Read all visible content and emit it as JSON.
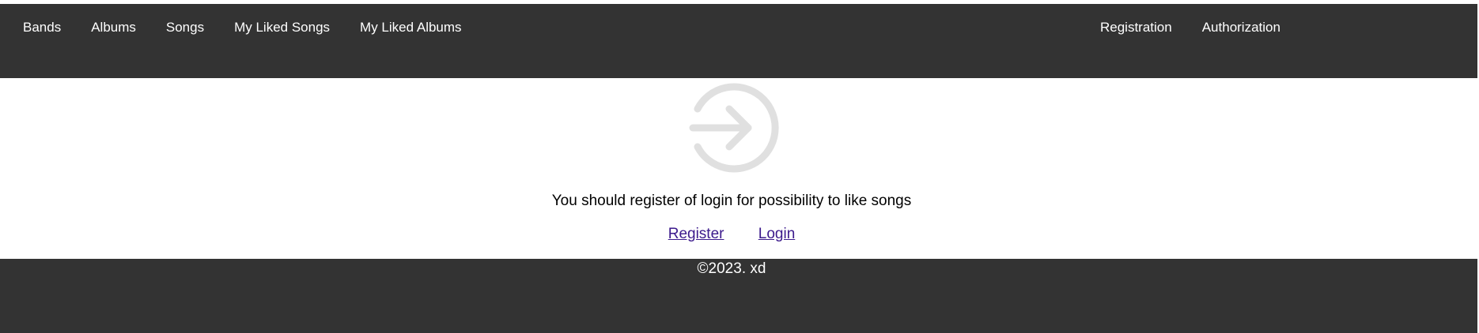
{
  "nav": {
    "left_items": [
      {
        "label": "Bands"
      },
      {
        "label": "Albums"
      },
      {
        "label": "Songs"
      },
      {
        "label": "My Liked Songs"
      },
      {
        "label": "My Liked Albums"
      }
    ],
    "right_items": [
      {
        "label": "Registration"
      },
      {
        "label": "Authorization"
      }
    ]
  },
  "main": {
    "icon": "login-arrow-circle-icon",
    "message": "You should register of login for possibility to like songs",
    "register_link": "Register",
    "login_link": "Login"
  },
  "footer": {
    "copyright": "©2023. xd"
  },
  "colors": {
    "header_bg": "#333333",
    "footer_bg": "#333333",
    "link": "#3c1a8c",
    "icon": "#e0e0e0"
  }
}
